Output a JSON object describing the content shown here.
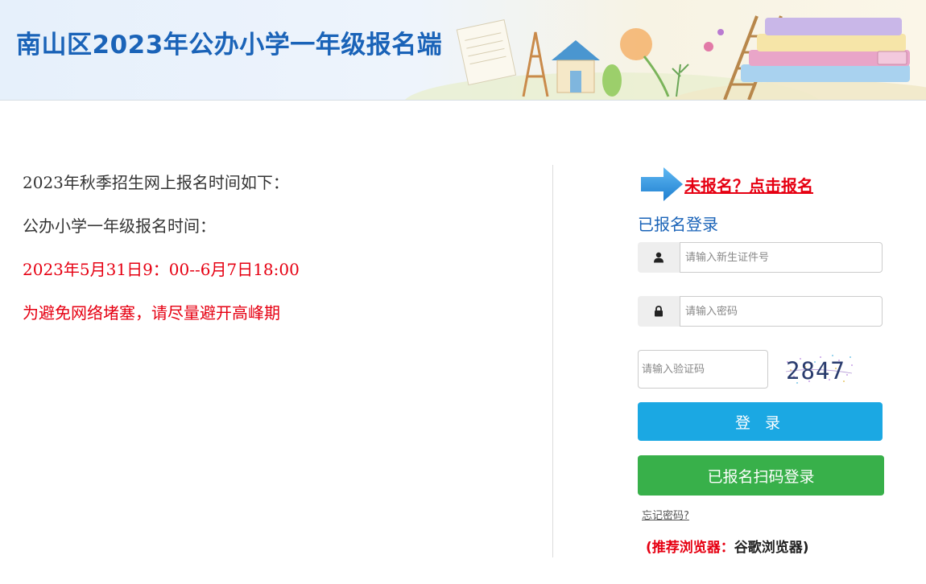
{
  "header": {
    "title": "南山区2023年公办小学一年级报名端"
  },
  "notice": {
    "line1": "2023年秋季招生网上报名时间如下：",
    "line2": "公办小学一年级报名时间：",
    "line3": "2023年5月31日9：00--6月7日18:00",
    "line4": "为避免网络堵塞，请尽量避开高峰期"
  },
  "login": {
    "register_link": "未报名？点击报名",
    "title": "已报名登录",
    "id_placeholder": "请输入新生证件号",
    "password_placeholder": "请输入密码",
    "captcha_placeholder": "请输入验证码",
    "captcha_code": "2847",
    "login_button": "登 录",
    "scan_button": "已报名扫码登录",
    "forgot_password": "忘记密码?",
    "browser_tip_prefix": "(推荐浏览器：",
    "browser_tip_suffix": "谷歌浏览器)"
  },
  "colors": {
    "title_blue": "#1a63b8",
    "alert_red": "#e60012",
    "login_button_blue": "#1ba8e3",
    "scan_button_green": "#38b04a"
  },
  "icons": {
    "user": "user-icon",
    "lock": "lock-icon",
    "arrow": "arrow-right-icon"
  }
}
